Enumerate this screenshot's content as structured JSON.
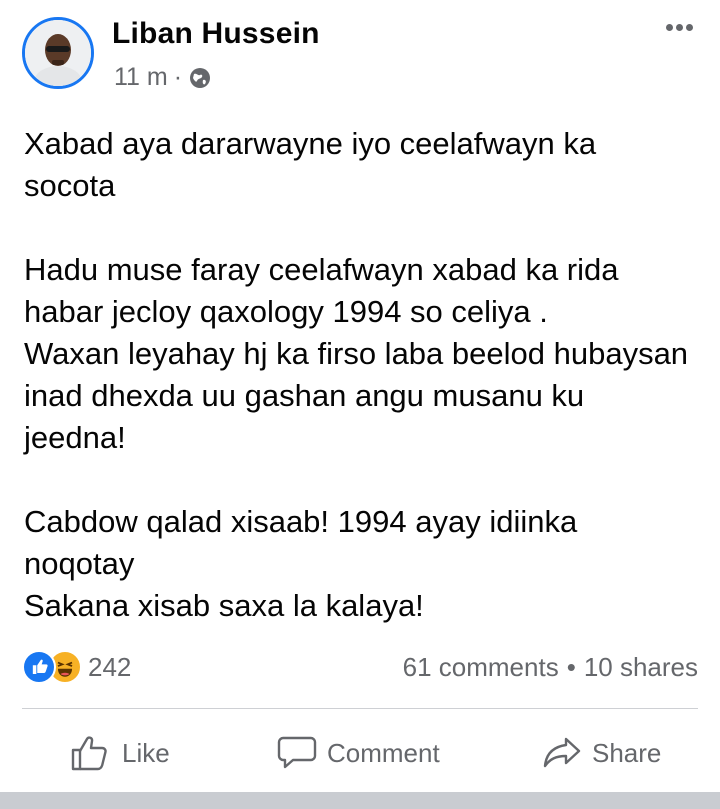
{
  "post": {
    "author": "Liban Hussein",
    "time": "11 m",
    "separator": "·",
    "privacy_icon": "globe-icon",
    "more_icon": "more-options-icon",
    "paragraphs": [
      "Xabad aya dararwayne iyo ceelafwayn ka socota",
      "Hadu muse faray ceelafwayn xabad ka rida habar jecloy qaxology 1994 so celiya .\nWaxan leyahay hj ka firso laba beelod hubaysan inad dhexda uu gashan angu musanu ku jeedna!",
      "Cabdow qalad xisaab! 1994 ayay idiinka noqotay\nSakana xisab saxa la kalaya!"
    ]
  },
  "stats": {
    "reaction_count": "242",
    "comments": "61 comments",
    "bullet": "•",
    "shares": "10 shares",
    "reaction_icons": [
      "like-reaction-icon",
      "haha-reaction-icon"
    ]
  },
  "actions": {
    "like": "Like",
    "comment": "Comment",
    "share": "Share"
  },
  "colors": {
    "accent": "#1877f2",
    "secondary_text": "#65676b",
    "haha": "#f7b125"
  }
}
